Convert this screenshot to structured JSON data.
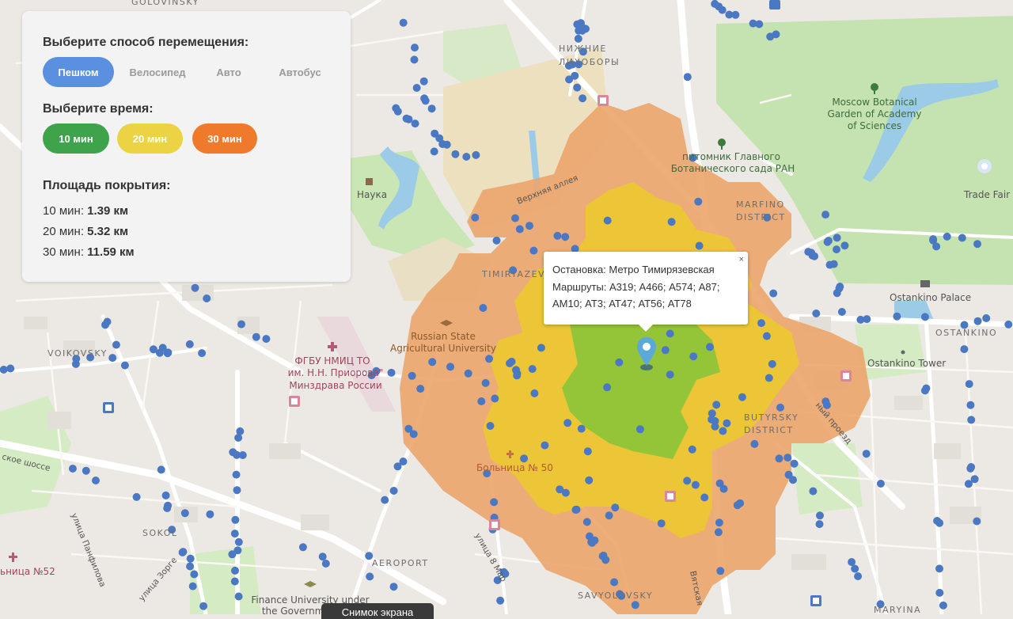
{
  "controls": {
    "mode_title": "Выберите способ перемещения:",
    "modes": [
      {
        "label": "Пешком",
        "active": true
      },
      {
        "label": "Велосипед",
        "active": false
      },
      {
        "label": "Авто",
        "active": false
      },
      {
        "label": "Автобус",
        "active": false
      }
    ],
    "time_title": "Выберите время:",
    "times": [
      {
        "label": "10 мин",
        "color": "#3fa34b"
      },
      {
        "label": "20 мин",
        "color": "#ecd344"
      },
      {
        "label": "30 мин",
        "color": "#f07a2c"
      }
    ],
    "coverage_title": "Площадь покрытия:",
    "coverage": [
      {
        "label": "10 мин: ",
        "value": "1.39 км"
      },
      {
        "label": "20 мин: ",
        "value": "5.32 км"
      },
      {
        "label": "30 мин: ",
        "value": "11.59 км"
      }
    ]
  },
  "popup": {
    "line1": "Остановка: Метро Тимирязевская",
    "line2": "Маршруты: А319; А466; А574; А87; АМ10; АТ3; АТ47; АТ56; АТ78",
    "close": "×"
  },
  "map_labels": {
    "golovinsky": "GOLOVINSKY",
    "nizhnie1": "НИЖНИЕ",
    "nizhnie2": "ЛИХОБОРЫ",
    "botanical1": "Moscow Botanical",
    "botanical2": "Garden of Academy",
    "botanical3": "of Sciences",
    "pitomnik1": "питомник Главного",
    "pitomnik2": "Ботанического сада РАН",
    "marfino1": "MARFINO",
    "marfino2": "DISTRICT",
    "nauka": "Наука",
    "verkhnyaya": "Верхняя аллея",
    "tradefair": "Trade Fair",
    "timiryazev": "TIMIRYAZEV",
    "ostankino_palace": "Ostankino Palace",
    "ostankino": "OSTANKINO",
    "ostankino_tower": "Ostankino Tower",
    "rsau1": "Russian State",
    "rsau2": "Agricultural University",
    "voikovsky": "VOIKOVSKY",
    "priorov1": "ФГБУ НМИЦ ТО",
    "priorov2": "им. Н.Н. Приорова\"",
    "priorov3": "Минздрава России",
    "butyrsky1": "BUTYRSKY",
    "butyrsky2": "DISTRICT",
    "proezd": "ный проезд",
    "shosse": "ское шоссе",
    "bolnica50": "Больница № 50",
    "sokol": "SOKOL",
    "panfilova": "улица Панфилова",
    "bolnica52": "ьница №52",
    "aeroport": "AEROPORT",
    "ul8": "улица 8 Мар",
    "zhabina": "улица Зорге",
    "finance1": "Finance University under",
    "finance2": "the Government",
    "savelovsky": "SAVYOLOVSKY",
    "maryina": "MARYINA",
    "vyatskaya": "Вятская"
  },
  "snapshot_button": "Снимок экрана",
  "colors": {
    "iso10": "#8cc43a",
    "iso20": "#ecc832",
    "iso30": "#eba56c",
    "stop": "#4a78c2",
    "park": "#c5e3b1"
  },
  "icons": [
    "map-pin-icon",
    "metro-icon",
    "hospital-icon",
    "university-icon",
    "tree-icon",
    "palace-icon",
    "tower-icon",
    "close-icon"
  ]
}
